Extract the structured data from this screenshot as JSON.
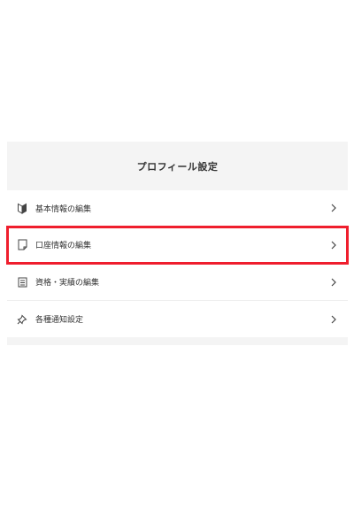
{
  "colors": {
    "highlight": "#ef1e2d",
    "panel_bg": "#f4f4f4",
    "text": "#333333"
  },
  "profile_settings": {
    "title": "プロフィール設定",
    "items": [
      {
        "label": "基本情報の編集",
        "icon": "beginner-mark-icon"
      },
      {
        "label": "口座情報の編集",
        "icon": "document-icon",
        "highlighted": true
      },
      {
        "label": "資格・実績の編集",
        "icon": "list-icon"
      },
      {
        "label": "各種通知設定",
        "icon": "pin-icon"
      }
    ]
  }
}
